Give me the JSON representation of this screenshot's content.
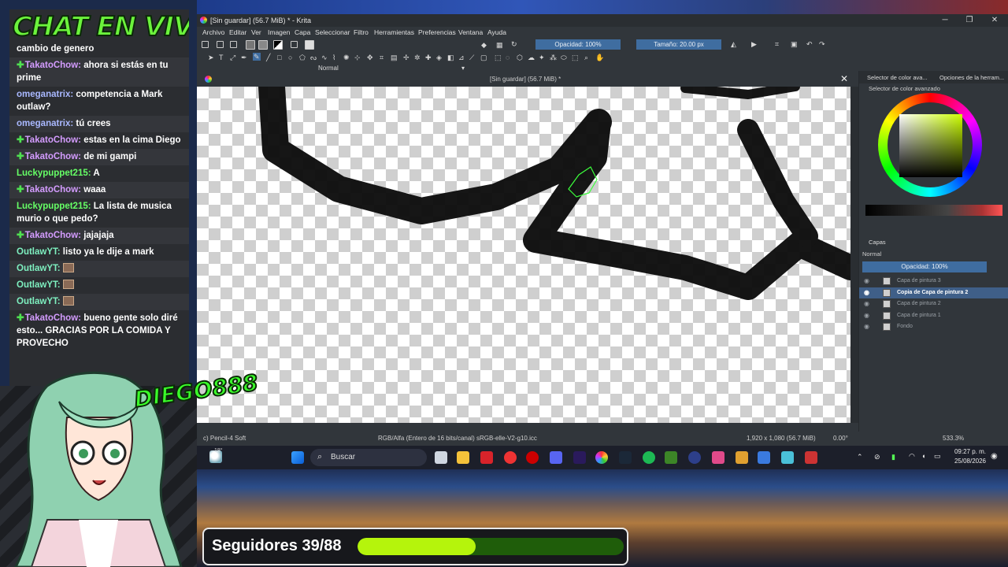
{
  "chat": {
    "title": "CHAT EN VIVO:",
    "messages": [
      {
        "user": "",
        "text": "cambio de genero",
        "diamond": false,
        "color": "plain"
      },
      {
        "user": "TakatoChow",
        "text": "ahora si estás en tu prime",
        "diamond": true,
        "color": "purple"
      },
      {
        "user": "omeganatrix",
        "text": "competencia a Mark outlaw?",
        "diamond": false,
        "color": "blue"
      },
      {
        "user": "omeganatrix",
        "text": "tú crees",
        "diamond": false,
        "color": "blue"
      },
      {
        "user": "TakatoChow",
        "text": "estas en la cima Diego",
        "diamond": true,
        "color": "purple"
      },
      {
        "user": "TakatoChow",
        "text": "de mi gampi",
        "diamond": true,
        "color": "purple"
      },
      {
        "user": "Luckypuppet215",
        "text": "A",
        "diamond": false,
        "color": "green"
      },
      {
        "user": "TakatoChow",
        "text": "waaa",
        "diamond": true,
        "color": "purple"
      },
      {
        "user": "Luckypuppet215",
        "text": "La lista de musica murio o que pedo?",
        "diamond": false,
        "color": "green"
      },
      {
        "user": "TakatoChow",
        "text": "jajajaja",
        "diamond": true,
        "color": "purple"
      },
      {
        "user": "OutlawYT",
        "text": "listo ya le dije a mark",
        "diamond": false,
        "color": "teal"
      },
      {
        "user": "OutlawYT",
        "text": "",
        "diamond": false,
        "color": "teal",
        "emote": true
      },
      {
        "user": "OutlawYT",
        "text": "",
        "diamond": false,
        "color": "teal",
        "emote": true
      },
      {
        "user": "OutlawYT",
        "text": "",
        "diamond": false,
        "color": "teal",
        "emote": true
      },
      {
        "user": "TakatoChow",
        "text": "bueno gente solo diré esto... GRACIAS POR LA COMIDA Y PROVECHO",
        "diamond": true,
        "color": "purple"
      }
    ]
  },
  "krita": {
    "window_title": "[Sin guardar]  (56.7 MiB) * - Krita",
    "menu": [
      "Archivo",
      "Editar",
      "Ver",
      "Imagen",
      "Capa",
      "Seleccionar",
      "Filtro",
      "Herramientas",
      "Preferencias",
      "Ventana",
      "Ayuda"
    ],
    "blend_mode": "Normal",
    "opacity_label": "Opacidad: 100%",
    "size_label": "Tamaño: 20.00 px",
    "doc_tab": "[Sin guardar]  (56.7 MiB) *",
    "status": {
      "brush": "c) Pencil-4 Soft",
      "color_space": "RGB/Alfa (Entero de 16 bits/canal)  sRGB-elle-V2-g10.icc",
      "dimensions": "1,920 x 1,080 (56.7 MiB)",
      "rotation": "0.00°",
      "zoom": "533.3%"
    },
    "docker": {
      "tab1": "Selector de color ava...",
      "tab2": "Opciones de la herram...",
      "color_title": "Selector de color avanzado",
      "layers_title": "Capas",
      "layers_blend": "Normal",
      "layers_opacity": "Opacidad:  100%",
      "layers": [
        {
          "name": "Capa de pintura 3",
          "selected": false
        },
        {
          "name": "Copia de Capa de pintura 2",
          "selected": true
        },
        {
          "name": "Capa de pintura 2",
          "selected": false
        },
        {
          "name": "Capa de pintura 1",
          "selected": false
        },
        {
          "name": "Fondo",
          "selected": false
        }
      ]
    }
  },
  "taskbar": {
    "weather": "18°",
    "search": "Buscar",
    "time": "09:27 p. m.",
    "date": "25/08/2026"
  },
  "overlay": {
    "badge": "DIEGO888",
    "followers_label": "Seguidores 39/88",
    "followers_progress": 0.443
  }
}
